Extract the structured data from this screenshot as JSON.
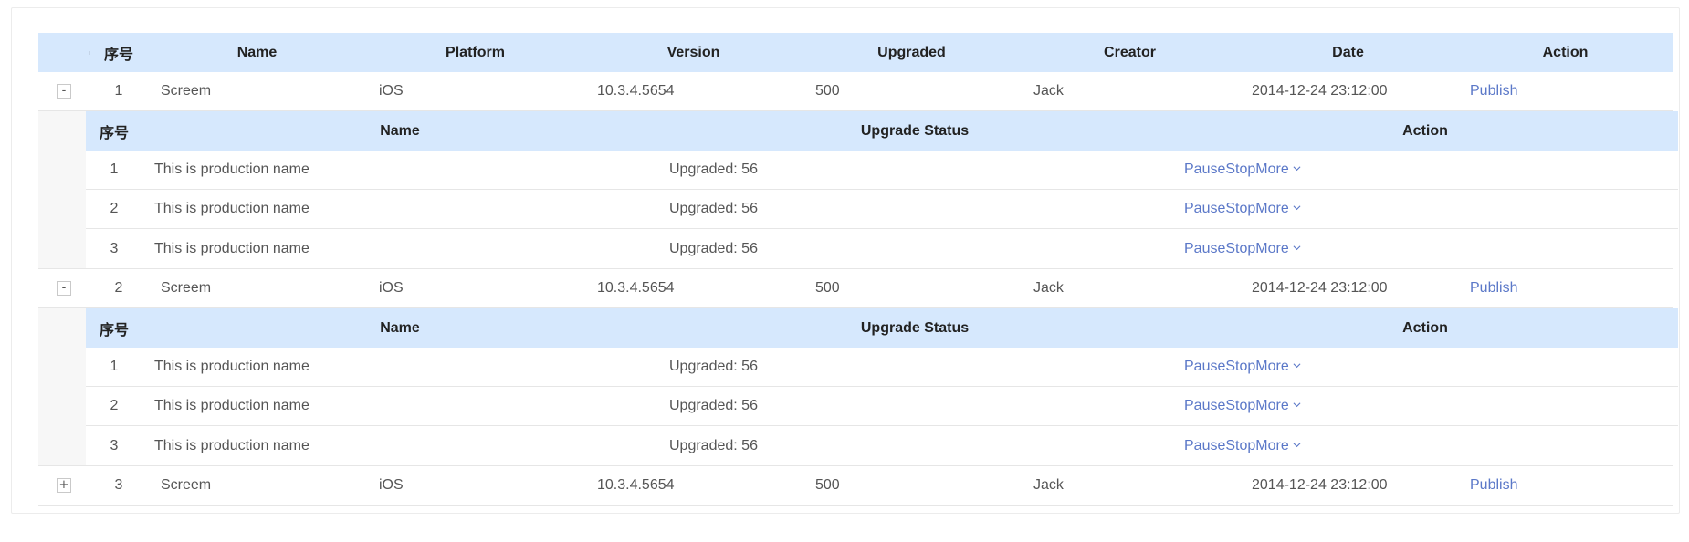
{
  "outer_table": {
    "headers": [
      "",
      "序号",
      "Name",
      "Platform",
      "Version",
      "Upgraded",
      "Creator",
      "Date",
      "Action"
    ],
    "rows": [
      {
        "expander": "-",
        "no": "1",
        "name": "Screem",
        "platform": "iOS",
        "version": "10.3.4.5654",
        "upgraded": "500",
        "creator": "Jack",
        "date": "2014-12-24 23:12:00",
        "action": "Publish",
        "expanded": true
      },
      {
        "expander": "-",
        "no": "2",
        "name": "Screem",
        "platform": "iOS",
        "version": "10.3.4.5654",
        "upgraded": "500",
        "creator": "Jack",
        "date": "2014-12-24 23:12:00",
        "action": "Publish",
        "expanded": true
      },
      {
        "expander": "+",
        "no": "3",
        "name": "Screem",
        "platform": "iOS",
        "version": "10.3.4.5654",
        "upgraded": "500",
        "creator": "Jack",
        "date": "2014-12-24 23:12:00",
        "action": "Publish",
        "expanded": false
      }
    ]
  },
  "nested_table": {
    "headers": [
      "序号",
      "Name",
      "Upgrade Status",
      "Action"
    ],
    "action_labels": {
      "pause": "Pause",
      "stop": "Stop",
      "more": "More"
    },
    "rows": [
      {
        "no": "1",
        "name": "This is production name",
        "status": "Upgraded: 56"
      },
      {
        "no": "2",
        "name": "This is production name",
        "status": "Upgraded: 56"
      },
      {
        "no": "3",
        "name": "This is production name",
        "status": "Upgraded: 56"
      }
    ]
  },
  "colors": {
    "header_bg": "#d6e8fd",
    "link": "#5b78c8"
  }
}
